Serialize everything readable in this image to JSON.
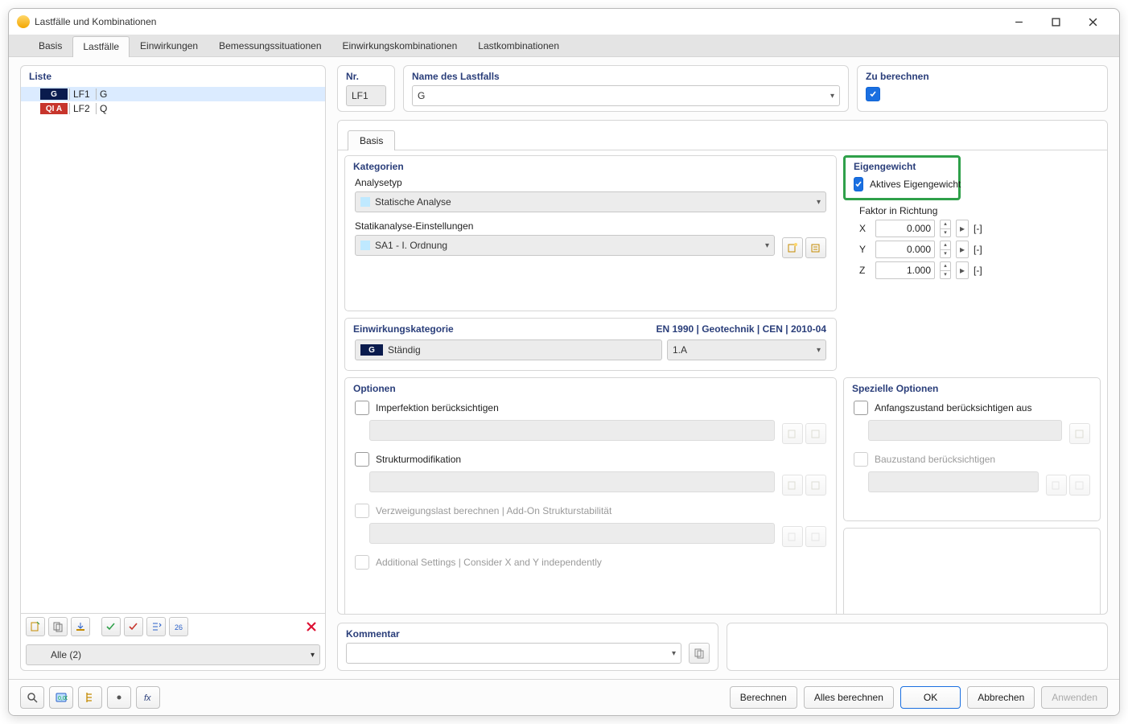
{
  "window": {
    "title": "Lastfälle und Kombinationen"
  },
  "tabs": {
    "items": [
      "Basis",
      "Lastfälle",
      "Einwirkungen",
      "Bemessungssituationen",
      "Einwirkungskombinationen",
      "Lastkombinationen"
    ],
    "active": 1
  },
  "list": {
    "title": "Liste",
    "rows": [
      {
        "tag": "G",
        "tagClass": "g",
        "lf": "LF1",
        "name": "G",
        "selected": true
      },
      {
        "tag": "QI A",
        "tagClass": "q",
        "lf": "LF2",
        "name": "Q",
        "selected": false
      }
    ],
    "filter": "Alle (2)"
  },
  "top": {
    "nr_label": "Nr.",
    "nr_value": "LF1",
    "name_label": "Name des Lastfalls",
    "name_value": "G",
    "calc_label": "Zu berechnen",
    "calc_checked": true
  },
  "subtab": {
    "basis": "Basis"
  },
  "kategorien": {
    "title": "Kategorien",
    "analysetyp_label": "Analysetyp",
    "analysetyp_value": "Statische Analyse",
    "statik_label": "Statikanalyse-Einstellungen",
    "statik_value": "SA1 - I. Ordnung"
  },
  "eigengewicht": {
    "title": "Eigengewicht",
    "active_label": "Aktives Eigengewicht",
    "active_checked": true,
    "factor_label": "Faktor in Richtung",
    "x": "0.000",
    "y": "0.000",
    "z": "1.000",
    "unit": "[-]",
    "xl": "X",
    "yl": "Y",
    "zl": "Z"
  },
  "ek": {
    "title": "Einwirkungskategorie",
    "standard": "EN 1990 | Geotechnik | CEN | 2010-04",
    "cat_tag": "G",
    "cat_text": "Ständig",
    "col2": "1.A"
  },
  "optionen": {
    "title": "Optionen",
    "imperfektion": "Imperfektion berücksichtigen",
    "struktur": "Strukturmodifikation",
    "verzweigung": "Verzweigungslast berechnen | Add-On Strukturstabilität",
    "additional": "Additional Settings | Consider X and Y independently"
  },
  "spezielle": {
    "title": "Spezielle Optionen",
    "anfang": "Anfangszustand berücksichtigen aus",
    "bauzustand": "Bauzustand berücksichtigen"
  },
  "kommentar": {
    "title": "Kommentar"
  },
  "footer": {
    "berechnen": "Berechnen",
    "alles": "Alles berechnen",
    "ok": "OK",
    "abbrechen": "Abbrechen",
    "anwenden": "Anwenden"
  }
}
